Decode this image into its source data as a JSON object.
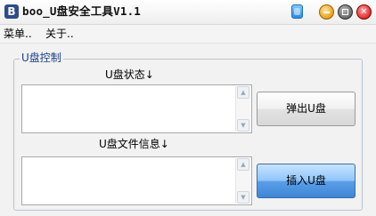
{
  "window": {
    "title": "boo_U盘安全工具V1.1",
    "app_icon_letter": "B",
    "controls": {
      "skin_icon": "skin-icon",
      "minimize_icon": "minimize-icon",
      "maximize_icon": "maximize-icon",
      "close_icon": "close-icon",
      "close_glyph": "✕"
    }
  },
  "menu": {
    "items": [
      {
        "label": "菜单.."
      },
      {
        "label": "关于.."
      }
    ]
  },
  "usb_control": {
    "group_title": "U盘控制",
    "status_label": "U盘状态↓",
    "status_value": "",
    "file_info_label": "U盘文件信息↓",
    "file_info_value": "",
    "eject_button": "弹出U盘",
    "insert_button": "插入U盘"
  },
  "colors": {
    "group_title": "#1b3f88",
    "insert_button_blue": "#5b9fe8",
    "close_red": "#e03030",
    "minimize_orange": "#e8a020"
  }
}
